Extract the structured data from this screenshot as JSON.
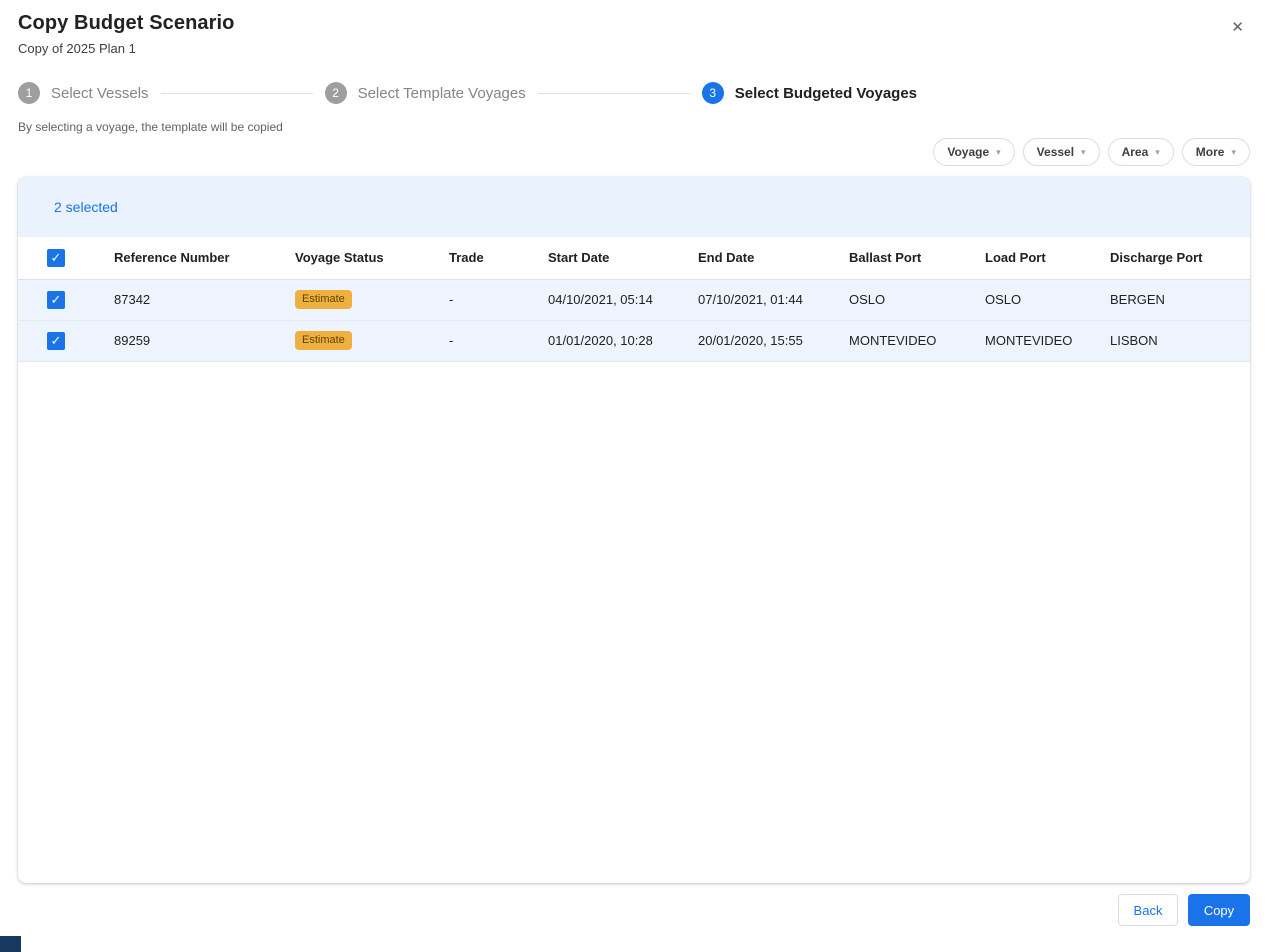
{
  "dialog": {
    "title": "Copy Budget Scenario",
    "subtitle": "Copy of 2025 Plan 1"
  },
  "stepper": {
    "steps": [
      {
        "number": "1",
        "label": "Select Vessels",
        "active": false
      },
      {
        "number": "2",
        "label": "Select Template Voyages",
        "active": false
      },
      {
        "number": "3",
        "label": "Select Budgeted Voyages",
        "active": true
      }
    ]
  },
  "hint": "By selecting a voyage, the template will be copied",
  "filters": [
    {
      "label": "Voyage"
    },
    {
      "label": "Vessel"
    },
    {
      "label": "Area"
    },
    {
      "label": "More"
    }
  ],
  "table": {
    "selected_count_text": "2 selected",
    "columns": [
      "Reference Number",
      "Voyage Status",
      "Trade",
      "Start Date",
      "End Date",
      "Ballast Port",
      "Load Port",
      "Discharge Port"
    ],
    "rows": [
      {
        "checked": true,
        "reference_number": "87342",
        "voyage_status": "Estimate",
        "trade": "-",
        "start_date": "04/10/2021, 05:14",
        "end_date": "07/10/2021, 01:44",
        "ballast_port": "OSLO",
        "load_port": "OSLO",
        "discharge_port": "BERGEN"
      },
      {
        "checked": true,
        "reference_number": "89259",
        "voyage_status": "Estimate",
        "trade": "-",
        "start_date": "01/01/2020, 10:28",
        "end_date": "20/01/2020, 15:55",
        "ballast_port": "MONTEVIDEO",
        "load_port": "MONTEVIDEO",
        "discharge_port": "LISBON"
      }
    ]
  },
  "footer": {
    "back_label": "Back",
    "copy_label": "Copy"
  },
  "colors": {
    "accent": "#1a73e8",
    "badge_bg": "#eeb140",
    "badge_text": "#5f4200",
    "selection_bg": "#e9f2fd",
    "row_selected_bg": "#eef4fe",
    "step_inactive": "#9e9e9e"
  }
}
